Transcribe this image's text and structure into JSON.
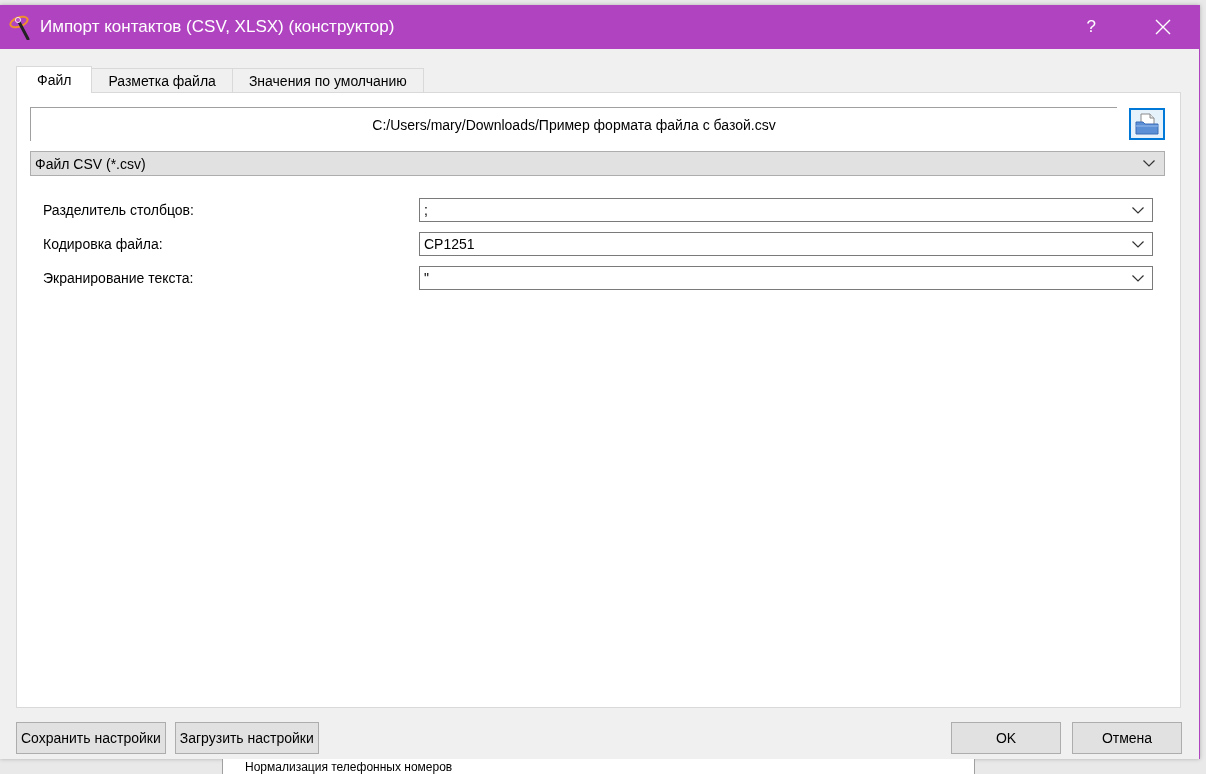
{
  "window": {
    "title": "Импорт контактов (CSV, XLSX) (конструктор)",
    "help_button": "?"
  },
  "tabs": [
    {
      "label": "Файл",
      "selected": true
    },
    {
      "label": "Разметка файла",
      "selected": false
    },
    {
      "label": "Значения по умолчанию",
      "selected": false
    }
  ],
  "file_path": {
    "value": "C:/Users/mary/Downloads/Пример формата файла с базой.csv"
  },
  "file_type": {
    "value": "Файл CSV (*.csv)"
  },
  "settings": [
    {
      "label": "Разделитель столбцов:",
      "value": ";"
    },
    {
      "label": "Кодировка файла:",
      "value": "CP1251"
    },
    {
      "label": "Экранирование текста:",
      "value": "\""
    }
  ],
  "footer_buttons_left": [
    "Сохранить настройки",
    "Загрузить настройки"
  ],
  "footer_buttons_right": [
    "OK",
    "Отмена"
  ],
  "background_window": {
    "row_text": "Нормализация телефонных номеров"
  }
}
